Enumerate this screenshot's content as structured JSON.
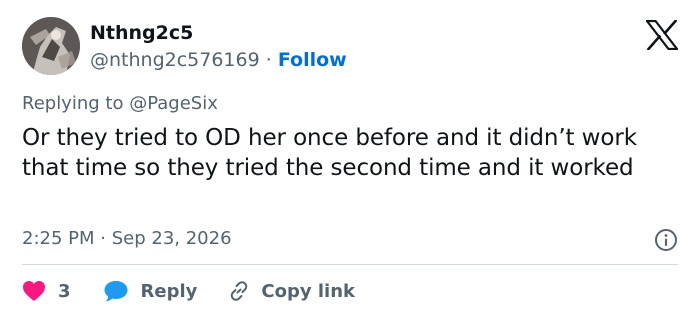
{
  "user": {
    "display_name": "Nthng2c5",
    "handle": "@nthng2c576169",
    "separator": "·",
    "follow_label": "Follow"
  },
  "tweet": {
    "replying_prefix": "Replying to",
    "replying_to": "@PageSix",
    "text": "Or they tried to OD her once before and it didn’t work that time so they tried the second time and it worked",
    "time": "2:25 PM",
    "date_separator": "·",
    "date": "Sep 23, 2026"
  },
  "actions": {
    "like_count": "3",
    "reply_label": "Reply",
    "copy_label": "Copy link"
  },
  "icons": {
    "logo": "x-logo-icon",
    "info": "info-icon",
    "like": "heart-icon",
    "reply": "speech-bubble-icon",
    "copy": "link-icon"
  },
  "colors": {
    "text": "#0f1419",
    "secondary": "#536471",
    "link": "#006fd6",
    "like": "#f91880",
    "reply": "#1d9bf0",
    "divider": "#cfd9de"
  }
}
